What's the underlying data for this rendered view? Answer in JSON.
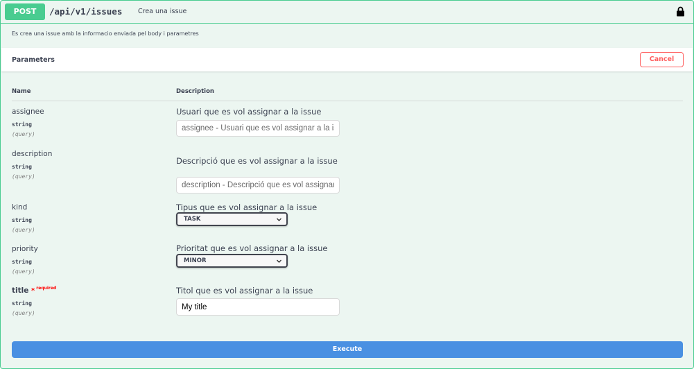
{
  "operation": {
    "method": "POST",
    "path": "/api/v1/issues",
    "summary": "Crea una issue",
    "description": "Es crea una issue amb la informacio enviada pel body i parametres"
  },
  "parameters_section": {
    "title": "Parameters",
    "cancel_label": "Cancel",
    "col_name": "Name",
    "col_description": "Description"
  },
  "params": [
    {
      "name": "assignee",
      "type": "string",
      "in": "(query)",
      "description": "Usuari que es vol assignar a la issue",
      "placeholder": "assignee - Usuari que es vol assignar a la issue",
      "value": ""
    },
    {
      "name": "description",
      "type": "string",
      "in": "(query)",
      "description": "Descripció que es vol assignar a la issue",
      "placeholder": "description - Descripció que es vol assignar a la issue",
      "value": ""
    },
    {
      "name": "kind",
      "type": "string",
      "in": "(query)",
      "description": "Tipus que es vol assignar a la issue",
      "selected": "TASK"
    },
    {
      "name": "priority",
      "type": "string",
      "in": "(query)",
      "description": "Prioritat que es vol assignar a la issue",
      "selected": "MINOR"
    },
    {
      "name": "title",
      "type": "string",
      "in": "(query)",
      "required_star": "*",
      "required_label": "required",
      "description": "Titol que es vol assignar a la issue",
      "placeholder": "",
      "value": "My title"
    }
  ],
  "execute_label": "Execute",
  "icons": {
    "lock": "lock-icon",
    "chevron": "chevron-down-icon"
  },
  "colors": {
    "post": "#49cc90",
    "background": "#ecf6f1",
    "cancel": "#ff6060",
    "execute": "#4990e2"
  }
}
